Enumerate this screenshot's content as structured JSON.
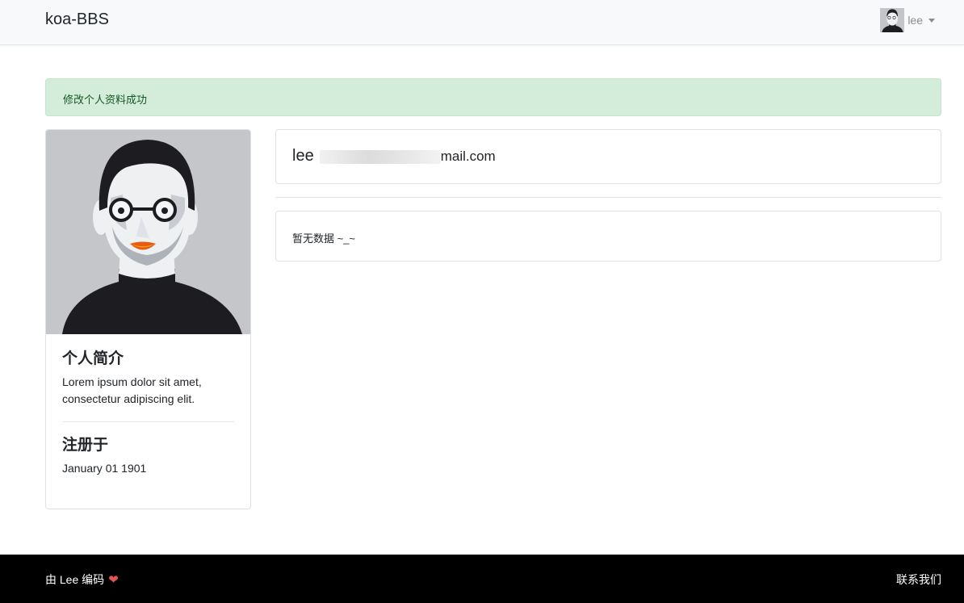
{
  "navbar": {
    "brand": "koa-BBS",
    "user": {
      "name": "lee"
    }
  },
  "alert": {
    "message": "修改个人资料成功"
  },
  "profile": {
    "avatar_icon": "user-portrait-icon",
    "bio_title": "个人简介",
    "bio_text": "Lorem ipsum dolor sit amet, consectetur adipiscing elit.",
    "registered_title": "注册于",
    "registered_date": "January 01 1901"
  },
  "info": {
    "username": "lee",
    "email_visible": "mail.com"
  },
  "posts": {
    "empty_text": "暂无数据 ~_~"
  },
  "footer": {
    "credit": "由 Lee 编码",
    "heart_icon": "heart-icon",
    "contact": "联系我们"
  },
  "colors": {
    "alert_bg": "#d4edda",
    "alert_text": "#155724",
    "navbar_bg": "#f8f9fa",
    "footer_bg": "#000000",
    "heart": "#e25555"
  }
}
